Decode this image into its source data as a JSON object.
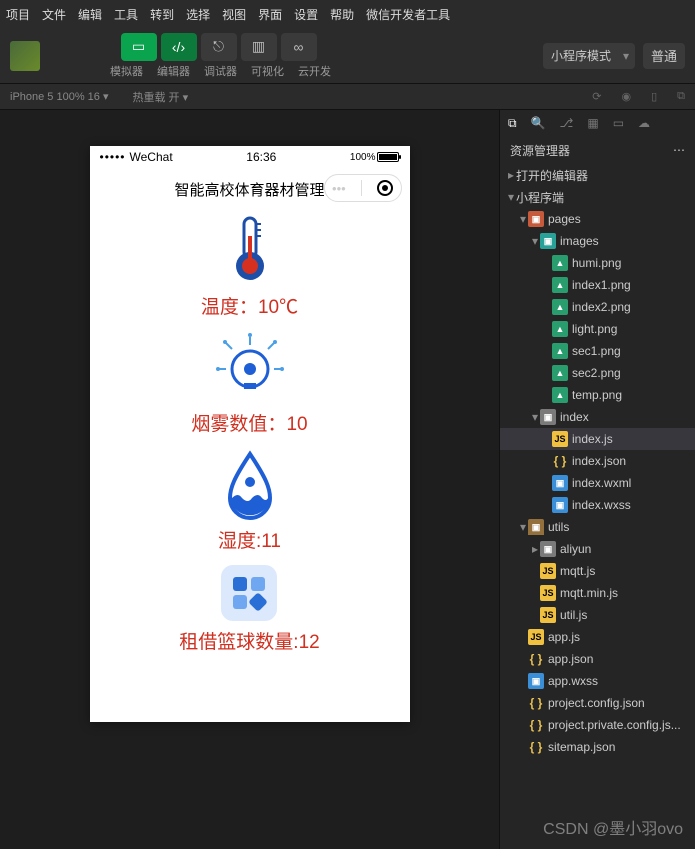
{
  "menubar": [
    "项目",
    "文件",
    "编辑",
    "工具",
    "转到",
    "选择",
    "视图",
    "界面",
    "设置",
    "帮助",
    "微信开发者工具"
  ],
  "toolbar": {
    "simulator": "模拟器",
    "editor": "编辑器",
    "debugger": "调试器",
    "visual": "可视化",
    "cloud": "云开发",
    "mode": "小程序模式",
    "compile": "普通"
  },
  "subbar": {
    "device": "iPhone 5 100% 16",
    "compile_label": "热重载 开"
  },
  "sidebar": {
    "title": "资源管理器",
    "open_editors": "打开的编辑器",
    "root": "小程序端"
  },
  "tree": {
    "pages": "pages",
    "images_folder": "images",
    "images": [
      "humi.png",
      "index1.png",
      "index2.png",
      "light.png",
      "sec1.png",
      "sec2.png",
      "temp.png"
    ],
    "index_folder": "index",
    "index_files": {
      "js": "index.js",
      "json": "index.json",
      "wxml": "index.wxml",
      "wxss": "index.wxss"
    },
    "utils_folder": "utils",
    "aliyun": "aliyun",
    "utils_files": {
      "mqtt": "mqtt.js",
      "mqttmin": "mqtt.min.js",
      "util": "util.js"
    },
    "root_files": {
      "appjs": "app.js",
      "appjson": "app.json",
      "appwxss": "app.wxss",
      "projconfig": "project.config.json",
      "projprivate": "project.private.config.js...",
      "sitemap": "sitemap.json"
    }
  },
  "phone": {
    "carrier": "WeChat",
    "time": "16:36",
    "battery": "100%",
    "title": "智能高校体育器材管理",
    "temp_label": "温度：",
    "temp_value": "10℃",
    "smoke_label": "烟雾数值：",
    "smoke_value": "10",
    "humi_label": "湿度:",
    "humi_value": "11",
    "ball_label": "租借篮球数量:",
    "ball_value": "12"
  },
  "watermark": "CSDN @墨小羽ovo"
}
